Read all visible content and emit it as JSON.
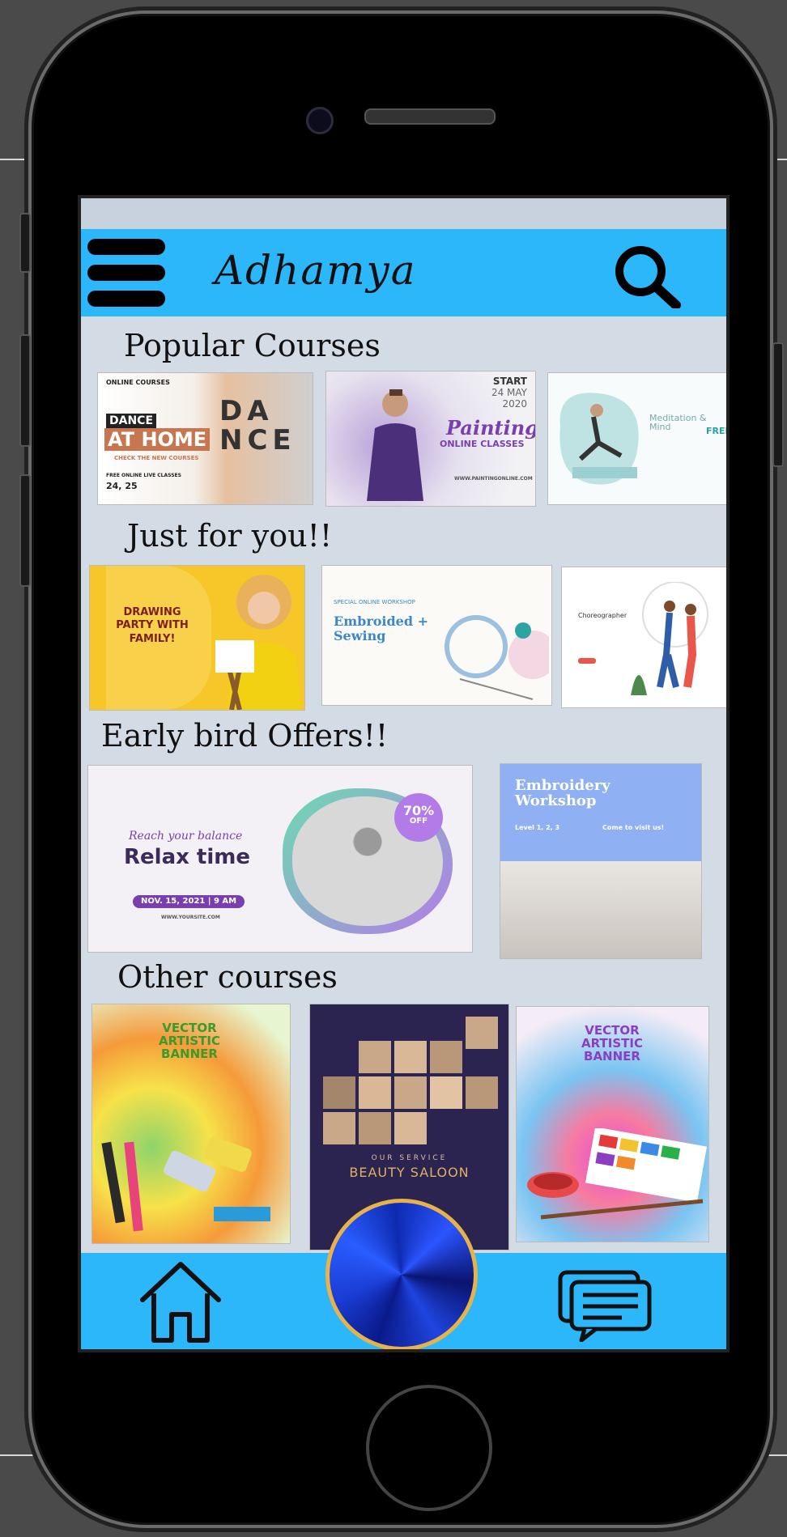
{
  "app": {
    "title": "Adhamya"
  },
  "sections": {
    "popular": {
      "title": "Popular Courses",
      "cards": [
        {
          "top": "ONLINE COURSES",
          "head": "DANCE",
          "main": "AT HOME",
          "sub": "CHECK THE NEW COURSES",
          "big": "DANCE",
          "date": "24, 25",
          "extra": "FREE ONLINE LIVE CLASSES"
        },
        {
          "top": "START",
          "date": "24 MAY",
          "year": "2020",
          "head": "Painting",
          "sub": "ONLINE CLASSES",
          "url": "WWW.PAINTINGONLINE.COM"
        },
        {
          "head": "Meditation & Mind",
          "sub": "FREE"
        }
      ]
    },
    "just_for_you": {
      "title": "Just for you!!",
      "cards": [
        {
          "head": "DRAWING PARTY WITH FAMILY!"
        },
        {
          "top": "SPECIAL ONLINE WORKSHOP",
          "head": "Embroided + Sewing"
        },
        {
          "head": "Choreographer"
        }
      ]
    },
    "early_bird": {
      "title": "Early bird Offers!!",
      "cards": [
        {
          "tag": "Reach your balance",
          "head": "Relax time",
          "date": "NOV. 15, 2021 | 9 AM",
          "badge": "70%",
          "badge_sub": "OFF",
          "url": "WWW.YOURSITE.COM"
        },
        {
          "head": "Embroidery Workshop",
          "sub": "Level 1, 2, 3",
          "cta": "Come to visit us!"
        }
      ]
    },
    "other": {
      "title": "Other courses",
      "cards": [
        {
          "head": "VECTOR ARTISTIC BANNER"
        },
        {
          "head": "BEAUTY SALOON",
          "sub": "OUR SERVICE"
        },
        {
          "head": "VECTOR ARTISTIC BANNER"
        }
      ]
    }
  },
  "icons": {
    "menu": "hamburger-menu-icon",
    "search": "search-icon",
    "home": "home-icon",
    "chat": "chat-icon"
  },
  "colors": {
    "accent": "#2db7fb",
    "background": "#d3dbe5"
  }
}
